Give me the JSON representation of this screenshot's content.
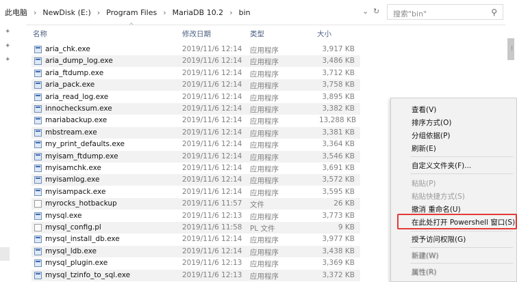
{
  "address": {
    "crumbs": [
      "此电脑",
      "NewDisk (E:)",
      "Program Files",
      "MariaDB 10.2",
      "bin"
    ],
    "search_placeholder": "搜索\"bin\""
  },
  "columns": {
    "name": "名称",
    "date": "修改日期",
    "type": "类型",
    "size": "大小"
  },
  "files": [
    {
      "name": "aria_chk.exe",
      "date": "2019/11/6 12:14",
      "type": "应用程序",
      "size": "3,917 KB",
      "icon": "exe-icon"
    },
    {
      "name": "aria_dump_log.exe",
      "date": "2019/11/6 12:14",
      "type": "应用程序",
      "size": "3,486 KB",
      "icon": "exe-icon"
    },
    {
      "name": "aria_ftdump.exe",
      "date": "2019/11/6 12:14",
      "type": "应用程序",
      "size": "3,712 KB",
      "icon": "exe-icon"
    },
    {
      "name": "aria_pack.exe",
      "date": "2019/11/6 12:14",
      "type": "应用程序",
      "size": "3,758 KB",
      "icon": "exe-icon"
    },
    {
      "name": "aria_read_log.exe",
      "date": "2019/11/6 12:14",
      "type": "应用程序",
      "size": "3,895 KB",
      "icon": "exe-icon"
    },
    {
      "name": "innochecksum.exe",
      "date": "2019/11/6 12:14",
      "type": "应用程序",
      "size": "3,382 KB",
      "icon": "exe-icon"
    },
    {
      "name": "mariabackup.exe",
      "date": "2019/11/6 12:14",
      "type": "应用程序",
      "size": "13,288 KB",
      "icon": "exe-icon"
    },
    {
      "name": "mbstream.exe",
      "date": "2019/11/6 12:14",
      "type": "应用程序",
      "size": "3,381 KB",
      "icon": "exe-icon"
    },
    {
      "name": "my_print_defaults.exe",
      "date": "2019/11/6 12:14",
      "type": "应用程序",
      "size": "3,364 KB",
      "icon": "exe-icon"
    },
    {
      "name": "myisam_ftdump.exe",
      "date": "2019/11/6 12:14",
      "type": "应用程序",
      "size": "3,546 KB",
      "icon": "exe-icon"
    },
    {
      "name": "myisamchk.exe",
      "date": "2019/11/6 12:14",
      "type": "应用程序",
      "size": "3,691 KB",
      "icon": "exe-icon"
    },
    {
      "name": "myisamlog.exe",
      "date": "2019/11/6 12:14",
      "type": "应用程序",
      "size": "3,572 KB",
      "icon": "exe-icon"
    },
    {
      "name": "myisampack.exe",
      "date": "2019/11/6 12:14",
      "type": "应用程序",
      "size": "3,595 KB",
      "icon": "exe-icon"
    },
    {
      "name": "myrocks_hotbackup",
      "date": "2019/11/6 11:57",
      "type": "文件",
      "size": "26 KB",
      "icon": "file-icon"
    },
    {
      "name": "mysql.exe",
      "date": "2019/11/6 12:13",
      "type": "应用程序",
      "size": "3,773 KB",
      "icon": "exe-icon"
    },
    {
      "name": "mysql_config.pl",
      "date": "2019/11/6 11:58",
      "type": "PL 文件",
      "size": "9 KB",
      "icon": "file-icon"
    },
    {
      "name": "mysql_install_db.exe",
      "date": "2019/11/6 12:14",
      "type": "应用程序",
      "size": "3,977 KB",
      "icon": "exe-icon"
    },
    {
      "name": "mysql_ldb.exe",
      "date": "2019/11/6 12:14",
      "type": "应用程序",
      "size": "3,438 KB",
      "icon": "exe-icon"
    },
    {
      "name": "mysql_plugin.exe",
      "date": "2019/11/6 12:13",
      "type": "应用程序",
      "size": "3,369 KB",
      "icon": "exe-icon"
    },
    {
      "name": "mysql_tzinfo_to_sql.exe",
      "date": "2019/11/6 12:13",
      "type": "应用程序",
      "size": "3,372 KB",
      "icon": "exe-icon"
    }
  ],
  "context_menu": {
    "view": "查看(V)",
    "sort": "排序方式(O)",
    "group": "分组依据(P)",
    "refresh": "刷新(E)",
    "customize": "自定义文件夹(F)...",
    "paste": "粘贴(P)",
    "paste_shortcut": "粘贴快捷方式(S)",
    "undo_rename": "撤消 重命名(U)",
    "open_powershell": "在此处打开 Powershell 窗口(S)",
    "grant_access": "授予访问权限(G)",
    "blurred_1": "新建(W)",
    "blurred_2": "属性(R)"
  },
  "colors": {
    "highlight_box": "#e53935",
    "menu_bg": "#f2f2f2",
    "alt_row": "#f2f2f2"
  }
}
